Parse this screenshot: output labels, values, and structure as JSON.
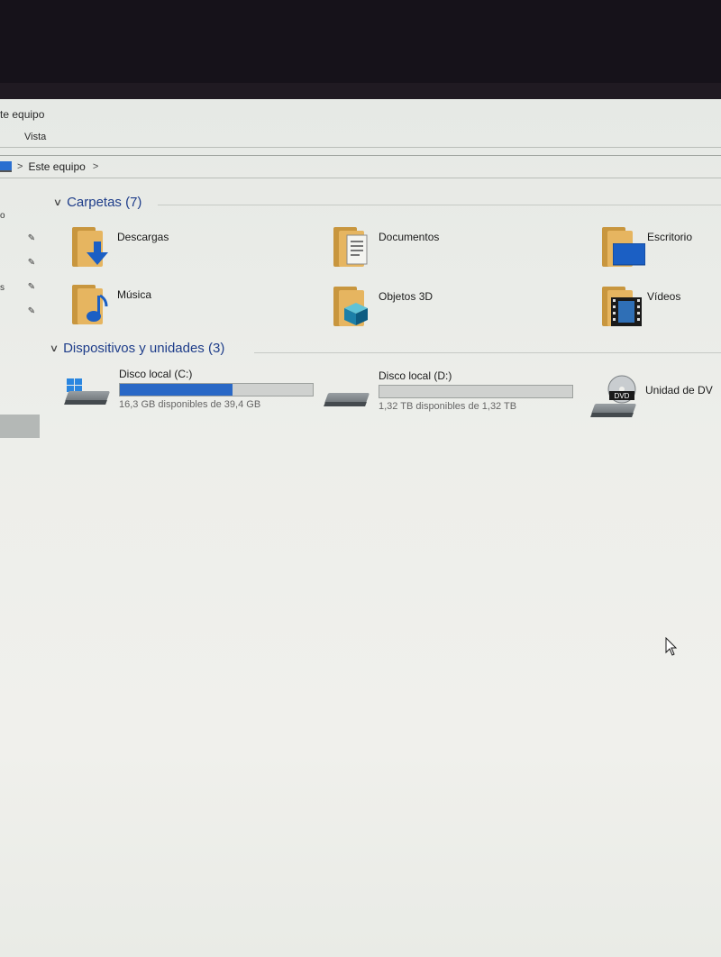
{
  "window": {
    "title_fragment": "te equipo"
  },
  "ribbon": {
    "tab_vista": "Vista"
  },
  "address_bar": {
    "location": "Este equipo"
  },
  "nav_pane": {
    "letters": [
      "o",
      "s"
    ]
  },
  "folders_section": {
    "title": "Carpetas (7)",
    "items": [
      {
        "label": "Descargas",
        "icon": "downloads-folder-icon"
      },
      {
        "label": "Documentos",
        "icon": "documents-folder-icon"
      },
      {
        "label": "Escritorio",
        "icon": "desktop-folder-icon"
      },
      {
        "label": "Música",
        "icon": "music-folder-icon"
      },
      {
        "label": "Objetos 3D",
        "icon": "3d-objects-folder-icon"
      },
      {
        "label": "Vídeos",
        "icon": "videos-folder-icon"
      }
    ]
  },
  "devices_section": {
    "title": "Dispositivos y unidades (3)",
    "drives": [
      {
        "label": "Disco local (C:)",
        "free_text": "16,3 GB disponibles de 39,4 GB",
        "used_fraction": 0.586,
        "bar_color": "#2968c6"
      },
      {
        "label": "Disco local (D:)",
        "free_text": "1,32 TB disponibles de 1,32 TB",
        "used_fraction": 0.0
      },
      {
        "label": "Unidad de DV",
        "icon": "dvd-drive-icon",
        "badge": "DVD"
      }
    ]
  }
}
